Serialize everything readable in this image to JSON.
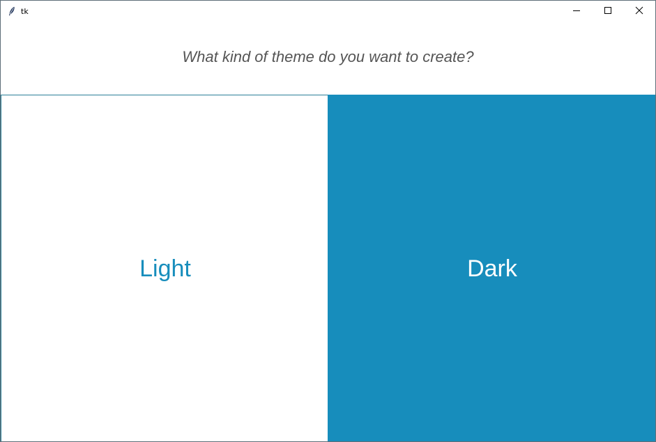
{
  "window": {
    "title": "tk",
    "app_icon": "tk-feather-icon",
    "controls": {
      "minimize_icon": "minimize-icon",
      "maximize_icon": "maximize-icon",
      "close_icon": "close-icon"
    }
  },
  "prompt": {
    "question": "What kind of theme do you want to create?"
  },
  "choices": [
    {
      "label": "Light",
      "background": "#ffffff",
      "text_color": "#178dbc"
    },
    {
      "label": "Dark",
      "background": "#178dbc",
      "text_color": "#ffffff"
    }
  ],
  "colors": {
    "accent": "#178dbc",
    "question_text": "#555555"
  }
}
